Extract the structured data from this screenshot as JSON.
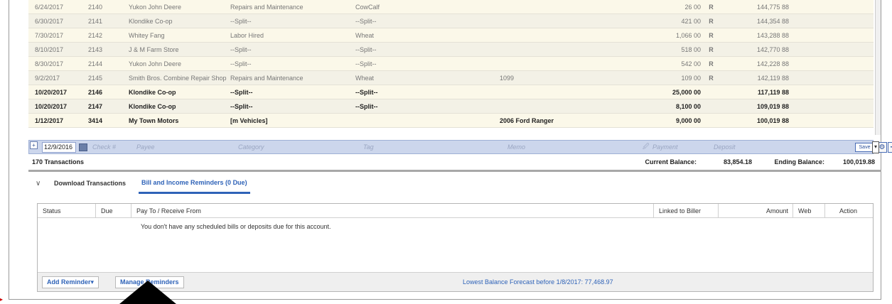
{
  "register": {
    "rows": [
      {
        "date": "6/24/2017",
        "num": "2140",
        "payee": "Yukon John Deere",
        "category": "Repairs and Maintenance",
        "tag": "CowCalf",
        "memo": "",
        "payment": "26 00",
        "cleared": "R",
        "deposit": "",
        "balance": "144,775 88",
        "style": "faded odd"
      },
      {
        "date": "6/30/2017",
        "num": "2141",
        "payee": "Klondike Co-op",
        "category": "--Split--",
        "tag": "--Split--",
        "memo": "",
        "payment": "421 00",
        "cleared": "R",
        "deposit": "",
        "balance": "144,354 88",
        "style": "faded even"
      },
      {
        "date": "7/30/2017",
        "num": "2142",
        "payee": "Whitey Fang",
        "category": "Labor Hired",
        "tag": "Wheat",
        "memo": "",
        "payment": "1,066 00",
        "cleared": "R",
        "deposit": "",
        "balance": "143,288 88",
        "style": "faded odd"
      },
      {
        "date": "8/10/2017",
        "num": "2143",
        "payee": "J & M Farm Store",
        "category": "--Split--",
        "tag": "--Split--",
        "memo": "",
        "payment": "518 00",
        "cleared": "R",
        "deposit": "",
        "balance": "142,770 88",
        "style": "faded even"
      },
      {
        "date": "8/30/2017",
        "num": "2144",
        "payee": "Yukon John Deere",
        "category": "--Split--",
        "tag": "--Split--",
        "memo": "",
        "payment": "542 00",
        "cleared": "R",
        "deposit": "",
        "balance": "142,228 88",
        "style": "faded odd"
      },
      {
        "date": "9/2/2017",
        "num": "2145",
        "payee": "Smith Bros. Combine Repair Shop",
        "category": "Repairs and Maintenance",
        "tag": "Wheat",
        "memo": "1099",
        "payment": "109 00",
        "cleared": "R",
        "deposit": "",
        "balance": "142,119 88",
        "style": "faded even"
      },
      {
        "date": "10/20/2017",
        "num": "2146",
        "payee": "Klondike Co-op",
        "category": "--Split--",
        "tag": "--Split--",
        "memo": "",
        "payment": "25,000 00",
        "cleared": "",
        "deposit": "",
        "balance": "117,119 88",
        "style": "bold odd"
      },
      {
        "date": "10/20/2017",
        "num": "2147",
        "payee": "Klondike Co-op",
        "category": "--Split--",
        "tag": "--Split--",
        "memo": "",
        "payment": "8,100 00",
        "cleared": "",
        "deposit": "",
        "balance": "109,019 88",
        "style": "bold even"
      },
      {
        "date": "1/12/2017",
        "num": "3414",
        "payee": "My Town Motors",
        "category": "[m Vehicles]",
        "tag": "",
        "memo": "2006 Ford Ranger",
        "payment": "9,000 00",
        "cleared": "",
        "deposit": "",
        "balance": "100,019 88",
        "style": "bold odd"
      }
    ],
    "entry": {
      "date": "12/9/2016",
      "check_placeholder": "Check #",
      "payee_placeholder": "Payee",
      "category_placeholder": "Category",
      "tag_placeholder": "Tag",
      "memo_placeholder": "Memo",
      "payment_placeholder": "Payment",
      "deposit_placeholder": "Deposit",
      "save_label": "Save"
    },
    "totals": {
      "count": "170 Transactions",
      "current_label": "Current Balance:",
      "current_value": "83,854.18",
      "ending_label": "Ending Balance:",
      "ending_value": "100,019.88"
    }
  },
  "tabs": {
    "collapse_glyph": "∨",
    "download": "Download Transactions",
    "reminders": "Bill and Income Reminders (0 Due)"
  },
  "reminders": {
    "headers": {
      "status": "Status",
      "due": "Due",
      "pay_to": "Pay To / Receive From",
      "linked": "Linked to Biller",
      "amount": "Amount",
      "web": "Web",
      "action": "Action"
    },
    "empty_message": "You don't have any scheduled bills or deposits due for this account.",
    "add_button": "Add Reminder",
    "manage_button": "Manage Reminders",
    "forecast": "Lowest Balance Forecast before 1/8/2017: 77,468.97"
  },
  "colors": {
    "accent": "#2f63b8",
    "entry_row": "#ccd6ec",
    "row_tint": "#fbf8e9"
  }
}
